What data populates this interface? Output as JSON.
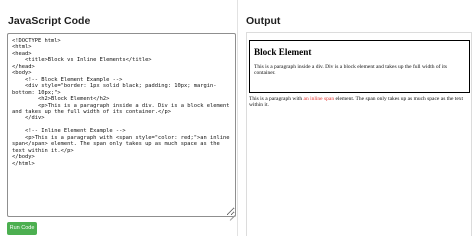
{
  "editor": {
    "title": "JavaScript Code",
    "code": "<!DOCTYPE html>\n<html>\n<head>\n    <title>Block vs Inline Elements</title>\n</head>\n<body>\n    <!-- Block Element Example -->\n    <div style=\"border: 1px solid black; padding: 10px; margin-bottom: 10px;\">\n        <h2>Block Element</h2>\n        <p>This is a paragraph inside a div. Div is a block element and takes up the full width of its container.</p>\n    </div>\n\n    <!-- Inline Element Example -->\n    <p>This is a paragraph with <span style=\"color: red;\">an inline span</span> element. The span only takes up as much space as the text within it.</p>\n</body>\n</html>",
    "run_label": "Run Code"
  },
  "output": {
    "title": "Output",
    "block_heading": "Block Element",
    "block_paragraph": "This is a paragraph inside a div. Div is a block element and takes up the full width of its container.",
    "inline_before": "This is a paragraph with ",
    "inline_span": "an inline span",
    "inline_after": " element. The span only takes up as much space as the text within it.",
    "span_color": "#e53935"
  },
  "colors": {
    "run_button": "#4caf50",
    "editor_border": "#8f8f8f",
    "divider": "#e2e2e2"
  }
}
